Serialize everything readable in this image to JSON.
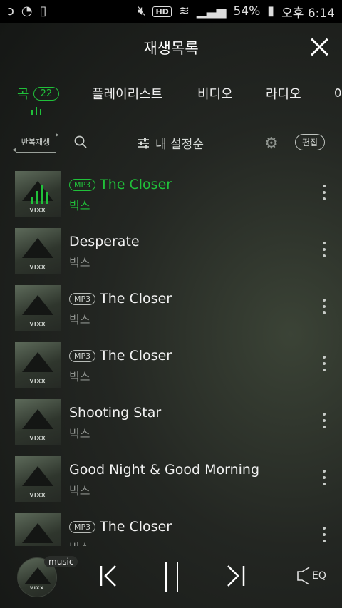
{
  "status_bar": {
    "left_icons": [
      "o",
      "o",
      "⌕"
    ],
    "battery": "54%",
    "time": "오후 6:14",
    "hd_label": "HD"
  },
  "header": {
    "title": "재생목록",
    "close_icon": "close-icon"
  },
  "tabs": [
    {
      "label": "곡",
      "count": "22",
      "active": true
    },
    {
      "label": "플레이리스트"
    },
    {
      "label": "비디오"
    },
    {
      "label": "라디오"
    },
    {
      "label": "아"
    }
  ],
  "toolbar": {
    "repeat_label": "반복재생",
    "sort_label": "내 설정순",
    "edit_label": "편집"
  },
  "tracks": [
    {
      "title": "The Closer",
      "artist": "빅스",
      "mp3": true,
      "playing": true
    },
    {
      "title": "Desperate",
      "artist": "빅스",
      "mp3": false
    },
    {
      "title": "The Closer",
      "artist": "빅스",
      "mp3": true
    },
    {
      "title": "The Closer",
      "artist": "빅스",
      "mp3": true
    },
    {
      "title": "Shooting Star",
      "artist": "빅스",
      "mp3": false
    },
    {
      "title": "Good Night & Good Morning",
      "artist": "빅스",
      "mp3": false
    },
    {
      "title": "The Closer",
      "artist": "빅스",
      "mp3": true
    }
  ],
  "mp3_label": "MP3",
  "album_text": "VIXX",
  "player": {
    "music_tag": "music",
    "eq_label": "EQ"
  },
  "colors": {
    "accent": "#20c13a",
    "background": "#232622"
  }
}
